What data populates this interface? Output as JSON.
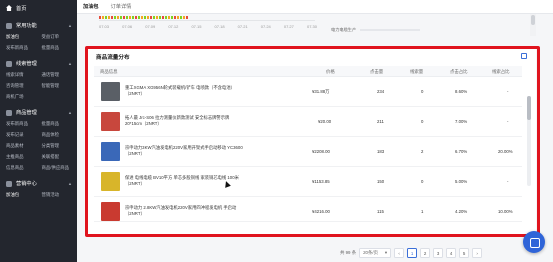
{
  "sidebar": {
    "home": "首页",
    "groups": [
      {
        "title": "常用功能",
        "links": [
          "加油包",
          "受益订单",
          "发布新商品",
          "批量商品"
        ]
      },
      {
        "title": "线索管理",
        "links": [
          "线索详情",
          "通话管理",
          "咨询管理",
          "智能管理",
          "商机广场"
        ]
      },
      {
        "title": "商品管理",
        "links": [
          "发布新商品",
          "批量商品",
          "发布记录",
          "商品体检",
          "商品素材",
          "分类管理",
          "主推商品",
          "关联搭配",
          "信息商品",
          "商品/供应商品"
        ]
      },
      {
        "title": "营销中心",
        "links": [
          "加油包",
          "营销活动"
        ]
      }
    ]
  },
  "tabs": [
    "加油包",
    "订单详情"
  ],
  "chart_strip": {
    "dates": [
      "07.03",
      "07.06",
      "07.09",
      "07.12",
      "07.15",
      "07.18",
      "07.21",
      "07.24",
      "07.27",
      "07.30"
    ]
  },
  "right_card": {
    "label": "电力电缆生产"
  },
  "card": {
    "title": "商品流量分布",
    "columns": [
      "商品信息",
      "价格",
      "点击量",
      "线索量",
      "点击占比",
      "线索占比"
    ],
    "rows": [
      {
        "name": "重工XGMA XG956N轮式装载机/铲车 电喷款（不含电池）（2NRT）",
        "price": "¥31.88万",
        "clicks": "234",
        "leads": "0",
        "click_share": "8.60%",
        "lead_share": "-",
        "thumb_color": "#5a5f66"
      },
      {
        "name": "拓人最 Jrc-S06 拉力测量仪新款测试 安全标志牌警示牌 20*15cm（2NRT）",
        "price": "¥20.00",
        "clicks": "211",
        "leads": "0",
        "click_share": "7.00%",
        "lead_share": "-",
        "thumb_color": "#c8473d"
      },
      {
        "name": "宗申动力3KW汽油发电机220V家用开架式手启动移动 YC3600（2NRT）",
        "price": "¥2208.00",
        "clicks": "183",
        "leads": "2",
        "click_share": "6.70%",
        "lead_share": "20.00%",
        "thumb_color": "#3a68b8"
      },
      {
        "name": "保进 电线电缆 BV10平方 单芯多股铜线 家装铜芯电线 100米（2NRT）",
        "price": "¥1153.85",
        "clicks": "150",
        "leads": "0",
        "click_share": "5.00%",
        "lead_share": "-",
        "thumb_color": "#d8b52a"
      },
      {
        "name": "宗申动力 2.8KW汽油发电机220V家用四冲程发电机 手启动（2NRT）",
        "price": "¥4216.00",
        "clicks": "115",
        "leads": "1",
        "click_share": "4.20%",
        "lead_share": "10.00%",
        "thumb_color": "#c93a30"
      }
    ]
  },
  "pager": {
    "total": "共 99 条",
    "page_size": "20条/页",
    "pages": [
      "1",
      "2",
      "3",
      "4",
      "5"
    ],
    "current": "1",
    "prev": "‹",
    "next": "›"
  }
}
